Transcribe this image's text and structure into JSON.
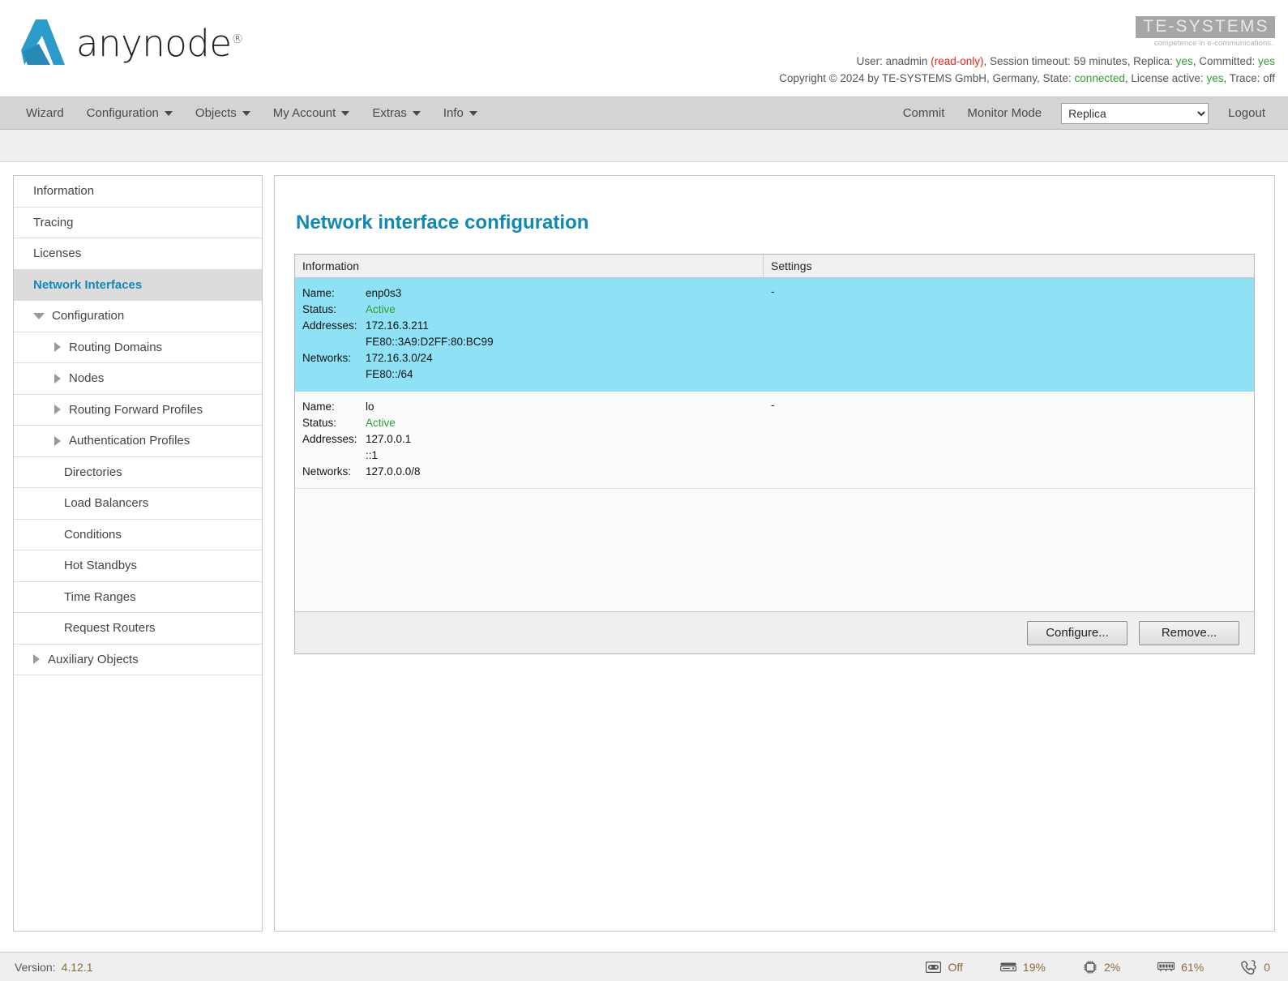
{
  "brand": {
    "product_name": "anynode",
    "registered_mark": "®",
    "company_name": "TE-SYSTEMS",
    "company_tagline": "competence in e-communications."
  },
  "header": {
    "line1": {
      "user_label": "User:",
      "user_name": "anadmin",
      "user_mode": "(read-only)",
      "session_label": ", Session timeout:",
      "session_value": "59 minutes",
      "replica_label": ", Replica:",
      "replica_value": "yes",
      "committed_label": ", Committed:",
      "committed_value": "yes"
    },
    "line2": {
      "copyright": "Copyright © 2024 by TE-SYSTEMS GmbH, Germany, State:",
      "state_value": "connected",
      "license_label": ", License active:",
      "license_value": "yes",
      "trace_label": ", Trace:",
      "trace_value": "off"
    }
  },
  "nav": {
    "left_items": [
      {
        "label": "Wizard",
        "has_caret": false
      },
      {
        "label": "Configuration",
        "has_caret": true
      },
      {
        "label": "Objects",
        "has_caret": true
      },
      {
        "label": "My Account",
        "has_caret": true
      },
      {
        "label": "Extras",
        "has_caret": true
      },
      {
        "label": "Info",
        "has_caret": true
      }
    ],
    "commit": "Commit",
    "monitor_mode": "Monitor Mode",
    "mode_select_value": "Replica",
    "mode_select_options": [
      "Replica"
    ],
    "logout": "Logout"
  },
  "sidebar": {
    "items": [
      {
        "label": "Information",
        "level": "root",
        "icon": "none",
        "selected": false
      },
      {
        "label": "Tracing",
        "level": "root",
        "icon": "none",
        "selected": false
      },
      {
        "label": "Licenses",
        "level": "root",
        "icon": "none",
        "selected": false
      },
      {
        "label": "Network Interfaces",
        "level": "root",
        "icon": "none",
        "selected": true
      },
      {
        "label": "Configuration",
        "level": "root-tree",
        "icon": "triangle-down-icon",
        "selected": false
      },
      {
        "label": "Routing Domains",
        "level": "child",
        "icon": "triangle-right-icon",
        "selected": false
      },
      {
        "label": "Nodes",
        "level": "child",
        "icon": "triangle-right-icon",
        "selected": false
      },
      {
        "label": "Routing Forward Profiles",
        "level": "child",
        "icon": "triangle-right-icon",
        "selected": false
      },
      {
        "label": "Authentication Profiles",
        "level": "child",
        "icon": "triangle-right-icon",
        "selected": false
      },
      {
        "label": "Directories",
        "level": "child-plain",
        "icon": "none",
        "selected": false
      },
      {
        "label": "Load Balancers",
        "level": "child-plain",
        "icon": "none",
        "selected": false
      },
      {
        "label": "Conditions",
        "level": "child-plain",
        "icon": "none",
        "selected": false
      },
      {
        "label": "Hot Standbys",
        "level": "child-plain",
        "icon": "none",
        "selected": false
      },
      {
        "label": "Time Ranges",
        "level": "child-plain",
        "icon": "none",
        "selected": false
      },
      {
        "label": "Request Routers",
        "level": "child-plain",
        "icon": "none",
        "selected": false
      },
      {
        "label": "Auxiliary Objects",
        "level": "root-tree",
        "icon": "triangle-right-icon",
        "selected": false
      }
    ]
  },
  "main": {
    "title": "Network interface configuration",
    "table": {
      "headers": {
        "information": "Information",
        "settings": "Settings"
      },
      "labels": {
        "name": "Name:",
        "status": "Status:",
        "addresses": "Addresses:",
        "networks": "Networks:"
      },
      "rows": [
        {
          "name": "enp0s3",
          "status": "Active",
          "addresses": "172.16.3.211\nFE80::3A9:D2FF:80:BC99",
          "networks": "172.16.3.0/24\nFE80::/64",
          "settings": "-",
          "selected": true
        },
        {
          "name": "lo",
          "status": "Active",
          "addresses": "127.0.0.1\n::1",
          "networks": "127.0.0.0/8",
          "settings": "-",
          "selected": false
        }
      ]
    },
    "buttons": {
      "configure": "Configure...",
      "remove": "Remove..."
    }
  },
  "footer": {
    "version_label": "Version:",
    "version_value": "4.12.1",
    "stats": [
      {
        "icon": "tape-recorder-icon",
        "value": "Off"
      },
      {
        "icon": "hard-disk-icon",
        "value": "19%"
      },
      {
        "icon": "cpu-chip-icon",
        "value": "2%"
      },
      {
        "icon": "memory-ram-icon",
        "value": "61%"
      },
      {
        "icon": "phone-calls-icon",
        "value": "0"
      }
    ]
  },
  "colors": {
    "accent": "#1189b8",
    "selection": "#8fe2f5",
    "green": "#2f9e2f",
    "red": "#e8231b",
    "footer_text": "#8a6a3a"
  }
}
